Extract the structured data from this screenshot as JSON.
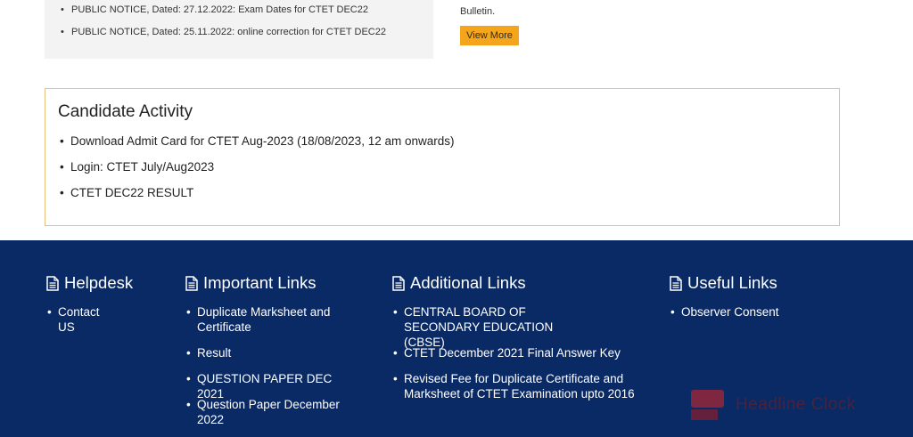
{
  "notices": {
    "items": [
      "PUBLIC NOTICE, Dated: 27.12.2022: Exam Dates for CTET DEC22",
      "PUBLIC NOTICE, Dated: 25.11.2022: online correction for CTET DEC22"
    ]
  },
  "bulletin": {
    "text": "Bulletin.",
    "view_more_label": "View More"
  },
  "candidate_activity": {
    "title": "Candidate Activity",
    "items": [
      "Download Admit Card for CTET Aug-2023 (18/08/2023, 12 am onwards)",
      "Login: CTET July/Aug2023",
      "CTET DEC22 RESULT"
    ]
  },
  "footer": {
    "background": "#0a2a66",
    "helpdesk": {
      "title": "Helpdesk",
      "icon": "document-icon",
      "links": [
        "Contact US"
      ]
    },
    "important_links": {
      "title": "Important Links",
      "icon": "document-icon",
      "links": [
        "Duplicate Marksheet and Certificate",
        "Result",
        "QUESTION PAPER DEC 2021",
        "Question Paper December 2022"
      ]
    },
    "additional_links": {
      "title": "Additional Links",
      "icon": "document-icon",
      "links": [
        "CENTRAL BOARD OF SECONDARY EDUCATION (CBSE)",
        "CTET December 2021 Final Answer Key",
        "Revised Fee for Duplicate Certificate and Marksheet of CTET Examination upto 2016"
      ]
    },
    "useful_links": {
      "title": "Useful Links",
      "icon": "document-icon",
      "links": [
        "Observer Consent"
      ]
    }
  },
  "watermark": {
    "text": "Headline Clock"
  },
  "colors": {
    "accent_button": "#f5a51b",
    "activity_border": "#e7c17a"
  }
}
